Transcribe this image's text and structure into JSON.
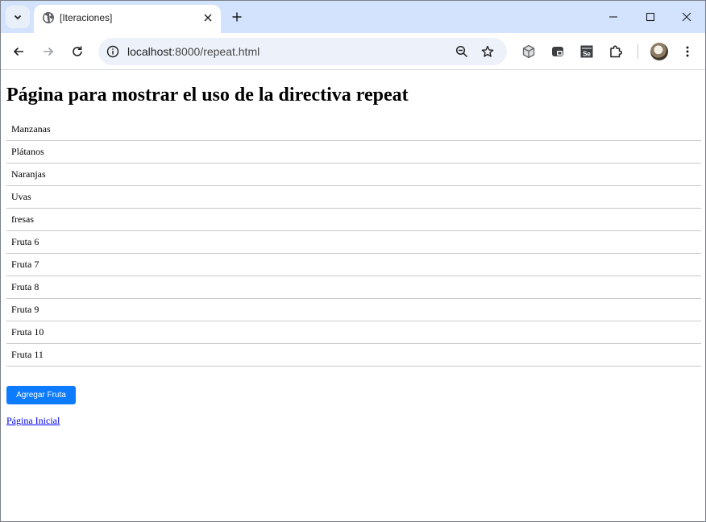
{
  "browser": {
    "tab_title": "[Iteraciones]",
    "url_host": "localhost",
    "url_path": ":8000/repeat.html"
  },
  "page": {
    "heading": "Página para mostrar el uso de la directiva repeat",
    "fruits": [
      "Manzanas",
      "Plátanos",
      "Naranjas",
      "Uvas",
      "fresas",
      "Fruta 6",
      "Fruta 7",
      "Fruta 8",
      "Fruta 9",
      "Fruta 10",
      "Fruta 11"
    ],
    "add_button_label": "Agregar Fruta",
    "home_link_label": "Página Inicial"
  },
  "colors": {
    "tabstrip": "#d3e3fd",
    "button": "#0d7bfd",
    "link": "#0000ee"
  }
}
